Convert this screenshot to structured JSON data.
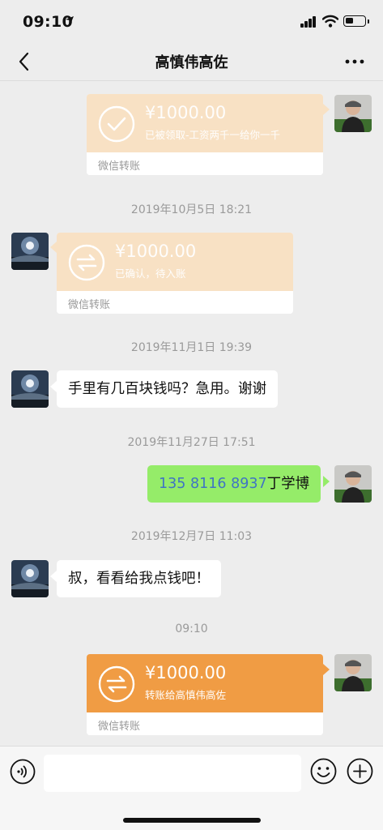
{
  "status_bar": {
    "time": "09:10"
  },
  "header": {
    "title": "高慎伟高佐"
  },
  "messages": [
    {
      "type": "transfer",
      "side": "right",
      "state": "received",
      "amount": "¥1000.00",
      "note": "已被领取-工资两千一给你一千",
      "footer": "微信转账"
    },
    {
      "type": "timestamp",
      "text": "2019年10月5日 18:21"
    },
    {
      "type": "transfer",
      "side": "left",
      "state": "pending",
      "amount": "¥1000.00",
      "note": "已确认，待入账",
      "footer": "微信转账"
    },
    {
      "type": "timestamp",
      "text": "2019年11月1日 19:39"
    },
    {
      "type": "text",
      "side": "left",
      "text": "手里有几百块钱吗？急用。谢谢"
    },
    {
      "type": "timestamp",
      "text": "2019年11月27日 17:51"
    },
    {
      "type": "text",
      "side": "right",
      "phone": "135 8116 8937",
      "text": "丁学博"
    },
    {
      "type": "timestamp",
      "text": "2019年12月7日 11:03"
    },
    {
      "type": "text",
      "side": "left",
      "text": "叔，看看给我点钱吧！"
    },
    {
      "type": "timestamp",
      "text": "09:10"
    },
    {
      "type": "transfer",
      "side": "right",
      "state": "sent",
      "amount": "¥1000.00",
      "note": "转账给高慎伟高佐",
      "footer": "微信转账"
    }
  ],
  "colors": {
    "transfer_pale": "#f8e1c4",
    "transfer_active": "#f09c44",
    "bubble_green": "#95ec69",
    "link_blue": "#3f74c4",
    "background": "#ededed"
  },
  "icons": [
    "location-arrow-icon",
    "signal-icon",
    "wifi-icon",
    "battery-icon",
    "back-chevron-icon",
    "more-dots-icon",
    "check-circle-icon",
    "exchange-arrows-icon",
    "voice-icon",
    "emoji-icon",
    "plus-icon"
  ]
}
